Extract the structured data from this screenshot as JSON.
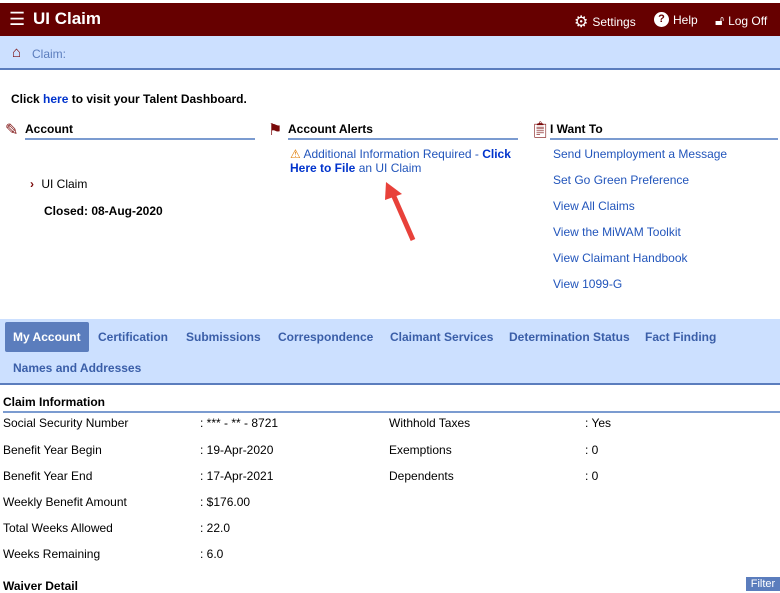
{
  "header": {
    "title": "UI Claim",
    "settings": "Settings",
    "help": "Help",
    "logoff": "Log Off"
  },
  "breadcrumb": {
    "label": "Claim:"
  },
  "talent": {
    "prefix": "Click ",
    "link": "here",
    "suffix": " to visit your Talent Dashboard."
  },
  "account": {
    "title": "Account",
    "item": "UI Claim",
    "closed": "Closed: 08-Aug-2020"
  },
  "alerts": {
    "title": "Account Alerts",
    "text": "Additional Information Required - ",
    "link_bold": "Click Here to File",
    "link_rest": " an UI Claim"
  },
  "want": {
    "title": "I Want To",
    "items": [
      "Send Unemployment a Message",
      "Set Go Green Preference",
      "View All Claims",
      "View the MiWAM Toolkit",
      "View Claimant Handbook",
      "View 1099-G"
    ]
  },
  "tabs": [
    "My Account",
    "Certification",
    "Submissions",
    "Correspondence",
    "Claimant Services",
    "Determination Status",
    "Fact Finding",
    "Names and Addresses"
  ],
  "claim_info": {
    "title": "Claim Information",
    "left": [
      {
        "label": "Social Security Number",
        "value": "*** - ** - 8721"
      },
      {
        "label": "Benefit Year Begin",
        "value": "19-Apr-2020"
      },
      {
        "label": "Benefit Year End",
        "value": "17-Apr-2021"
      },
      {
        "label": "Weekly Benefit Amount",
        "value": "$176.00"
      },
      {
        "label": "Total Weeks Allowed",
        "value": "22.0"
      },
      {
        "label": "Weeks Remaining",
        "value": "6.0"
      }
    ],
    "right": [
      {
        "label": "Withhold Taxes",
        "value": "Yes"
      },
      {
        "label": "Exemptions",
        "value": "0"
      },
      {
        "label": "Dependents",
        "value": "0"
      }
    ]
  },
  "waiver": {
    "title": "Waiver Detail",
    "filter": "Filter"
  },
  "colors": {
    "header": "#660000",
    "nav_bg": "#cce0ff",
    "accent": "#5b7dbd",
    "arrow": "#e8413a"
  }
}
